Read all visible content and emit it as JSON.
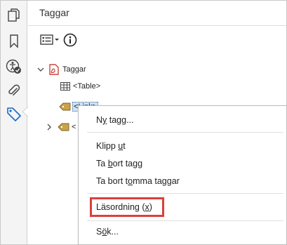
{
  "panel": {
    "title": "Taggar"
  },
  "sidebar": {
    "items": [
      {
        "icon": "copy-pages-icon"
      },
      {
        "icon": "bookmark-icon"
      },
      {
        "icon": "accessibility-check-icon"
      },
      {
        "icon": "paperclip-icon"
      },
      {
        "icon": "tag-icon",
        "active": true
      }
    ]
  },
  "toolbar": {
    "options_icon": "options-menu-icon",
    "info_icon": "info-icon"
  },
  "tree": {
    "root_label": "Taggar",
    "table_label": "<Table>",
    "link_label": "<Link>",
    "collapsed_label": "<"
  },
  "context_menu": {
    "items": [
      {
        "pre": "N",
        "u": "y",
        "post": " tagg..."
      },
      {
        "pre": "Klipp ",
        "u": "u",
        "post": "t"
      },
      {
        "pre": "Ta ",
        "u": "b",
        "post": "ort tagg"
      },
      {
        "pre": "Ta bort t",
        "u": "o",
        "post": "mma taggar"
      },
      {
        "pre": "Läsordning (",
        "u": "x",
        "post": ")"
      },
      {
        "pre": "S",
        "u": "ö",
        "post": "k..."
      }
    ]
  },
  "colors": {
    "highlight": "#d9403a",
    "active_icon": "#1b6ac9",
    "pdf_red": "#c8211b",
    "tag_gold": "#c9a24a"
  }
}
